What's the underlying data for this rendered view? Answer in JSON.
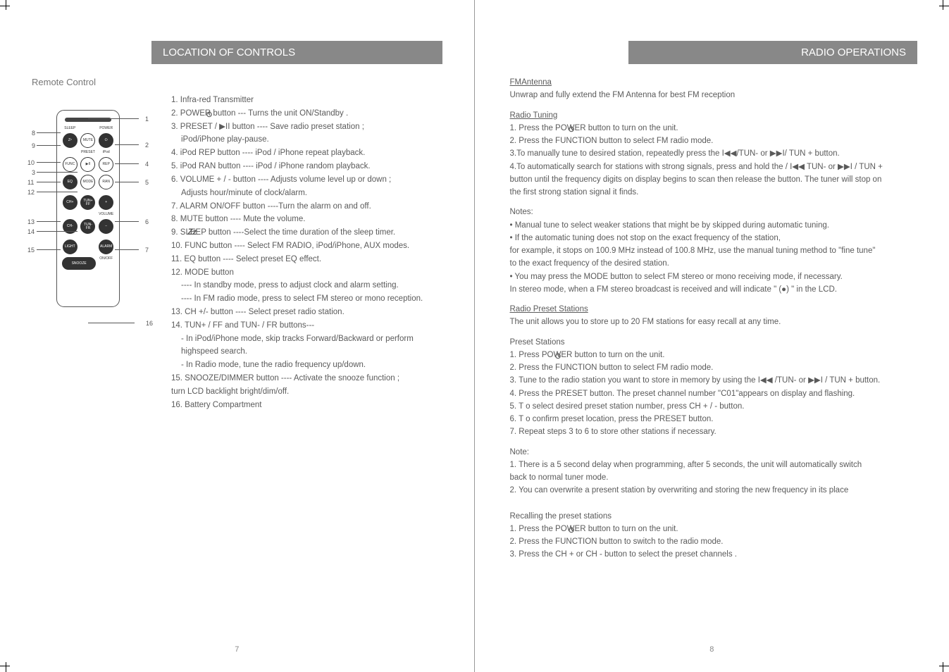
{
  "left": {
    "title": "LOCATION OF CONTROLS",
    "section_label": "Remote Control",
    "callouts": {
      "c1": "1",
      "c2": "2",
      "c3": "3",
      "c4": "4",
      "c5": "5",
      "c6": "6",
      "c7": "7",
      "c8": "8",
      "c9": "9",
      "c10": "10",
      "c11": "11",
      "c12": "12",
      "c13": "13",
      "c14": "14",
      "c15": "15",
      "c16": "16"
    },
    "remote_buttons": {
      "sleep": "SLEEP",
      "power": "POWER",
      "zz": "Z",
      "mute": "MUTE",
      "preset": "PRESET",
      "ipod": "iPod",
      "func": "FUNC",
      "playpause": "▶II",
      "rep": "REP",
      "eq": "EQ",
      "mode": "MODE",
      "ran": "RAN",
      "chplus": "CH+",
      "tunplus": "TUN+\nFF",
      "volplus": "+",
      "volume": "VOLUME",
      "chminus": "CH-",
      "tunminus": "TUN-\nFR",
      "volminus": "−",
      "light": "LIGHT",
      "alarm": "ALARM",
      "snooze": "SNOOZE",
      "onoff": "ON/OFF"
    },
    "items": [
      "1.  Infra-red Transmitter",
      "2.  POWER      button --- Turns the unit ON/Standby     .",
      "3.  PRESET    /  ▶II  button  ---- Save radio preset station ;",
      "     iPod/iPhone play-pause.",
      "4.  iPod REP    button ---- iPod / iPhone repeat playback.",
      "5.  iPod RAN    button ---- iPod / iPhone random playback.",
      "6.  VOLUME + / -     button ---- Adjusts volume level up or down ;",
      "     Adjusts hour/minute of clock/alarm.",
      "7.  ALARM ON/OFF      button ----Turn the alarm on and off.",
      "8.  MUTE   button ---- Mute the volume.",
      "9.  SLEEP         button  ----Select the time duration of the sleep timer.",
      "10.  FUNC   button ---- Select  FM RADIO, iPod/iPhone, AUX modes.",
      "11.  EQ   button ---- Select preset EQ effect.",
      "12.  MODE   button",
      "        ---- In standby mode, press to adjust clock and alarm setting.",
      "        ---- In FM radio mode, press to select FM stereo or mono reception.",
      "13.   CH +/-   button ---- Select preset radio station.",
      "14.  TUN+ / FF    and  TUN-  / FR   buttons---",
      "       - In iPod/iPhone mode, skip tracks Forward/Backward or perform",
      "         highspeed search.",
      "       - In Radio mode, tune the radio frequency up/down.",
      "15.   SNOOZE/DIMMER     button ---- Activate the snooze function ;",
      "                                               turn LCD backlight bright/dim/off.",
      "16.  Battery Compartment"
    ],
    "page_num": "7"
  },
  "right": {
    "title": "RADIO OPERATIONS",
    "fmantenna": {
      "heading": "FMAntenna   ",
      "line1": "Unwrap  and fully extend the FM Antenna for best FM reception"
    },
    "tuning": {
      "heading": "Radio Tuning   ",
      "l1": "1. Press the POWER      button to turn on the unit.",
      "l2": "2. Press the   FUNCTION    button to select FM radio mode.",
      "l3": "3.To manually tune to desired station, repeatedly press the I◀◀/TUN- or    ▶▶I/ TUN  + button.",
      "l4a": "4.To automatically search for stations with strong signals, press and hold the      /  I◀◀   TUN- or ▶▶I /   TUN  +",
      "l4b": "   button until the frequency digits on display begins to scan then release the button. The tuner will stop on",
      "l4c": "   the first strong station signal it finds."
    },
    "notes1": {
      "heading": "Notes:",
      "n1": "•  Manual tune to select weaker stations that might be by skipped during automatic tuning.",
      "n2a": "•  If the automatic tuning does not stop on the exact  frequency of the station,  ",
      "n2b": "   for example, it stops on 100.9 MHz instead of 100.8 MHz, use the manual tuning method to \"fine tune\"",
      "n2c": "   to the exact frequency of the desired station.",
      "n3a": "•  You may press the    MODE   button to select FM stereo or mono receiving mode, if necessary.",
      "n3b": "    In stereo mode, when a FM stereo broadcast is received and will indicate \" (●) \" in the LCD."
    },
    "preset": {
      "heading": "Radio Preset Stations      ",
      "intro": "The unit allows you to store up to 20 FM stations for easy recall at any time.",
      "sub": "Preset Stations",
      "p1": "1. Press   POWER      button to turn on the unit.",
      "p2": "2. Press the    FUNCTION    button to select FM radio mode.",
      "p3": "3. Tune to the radio station you want to store in memory by using the I◀◀ /TUN- or  ▶▶I   / TUN  + button.",
      "p4": "4. Press the    PRESET     button. The preset channel number \"C01\"appears  on display and flashing.",
      "p5": "5. T o select desired preset station number, press       CH  + / -  button.",
      "p6": "6. T o confirm preset location, press the     PRESET     button.",
      "p7": "7. Repeat steps 3 to 6 to store other stations if necessary."
    },
    "note2": {
      "heading": "Note:",
      "n1a": "1. There is a 5 second delay when programming, after 5 seconds, the unit will automatically switch",
      "n1b": "    back to normal tuner mode.",
      "n2": "2. You can overwrite a present station by overwriting and storing the new frequency in its place"
    },
    "recall": {
      "heading": "Recalling the preset stations",
      "r1": "1. Press the    POWER       button to turn on the unit.",
      "r2": "2. Press the    FUNCTION    button to switch to the radio mode.",
      "r3": "3. Press the    CH +  or  CH -   button to select the preset channels    ."
    },
    "page_num": "8"
  }
}
